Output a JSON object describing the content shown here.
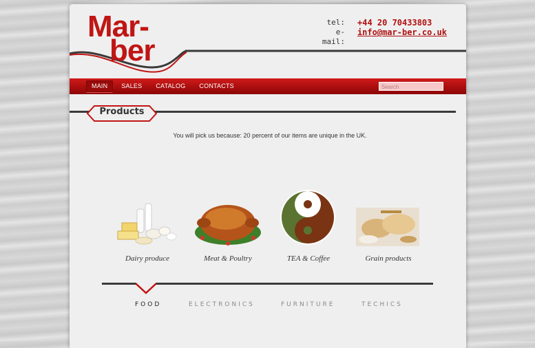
{
  "logo": {
    "line1": "Mar-",
    "line2": "ber"
  },
  "contact": {
    "tel_label": "tel:",
    "tel_value": "+44 20 70433803",
    "email_label": "e-mail:",
    "email_value": "info@mar-ber.co.uk"
  },
  "nav": {
    "items": [
      "MAIN",
      "SALES",
      "CATALOG",
      "CONTACTS"
    ],
    "active": "MAIN"
  },
  "search": {
    "placeholder": "Search"
  },
  "section": {
    "title": "Products",
    "tagline": "You will pick us because: 20 percent of our items are unique in the UK."
  },
  "products": [
    {
      "caption": "Dairy produce",
      "icon": "dairy-image"
    },
    {
      "caption": "Meat & Poultry",
      "icon": "roast-poultry-image"
    },
    {
      "caption": "TEA & Coffee",
      "icon": "tea-coffee-image"
    },
    {
      "caption": "Grain products",
      "icon": "bread-grain-image"
    }
  ],
  "tabs": {
    "items": [
      "FOOD",
      "ELECTRONICS",
      "FURNITURE",
      "TECHICS"
    ],
    "active": "FOOD"
  },
  "colors": {
    "brand_red": "#c01515",
    "nav_dark": "#8c0505",
    "page_bg": "#efefef"
  }
}
